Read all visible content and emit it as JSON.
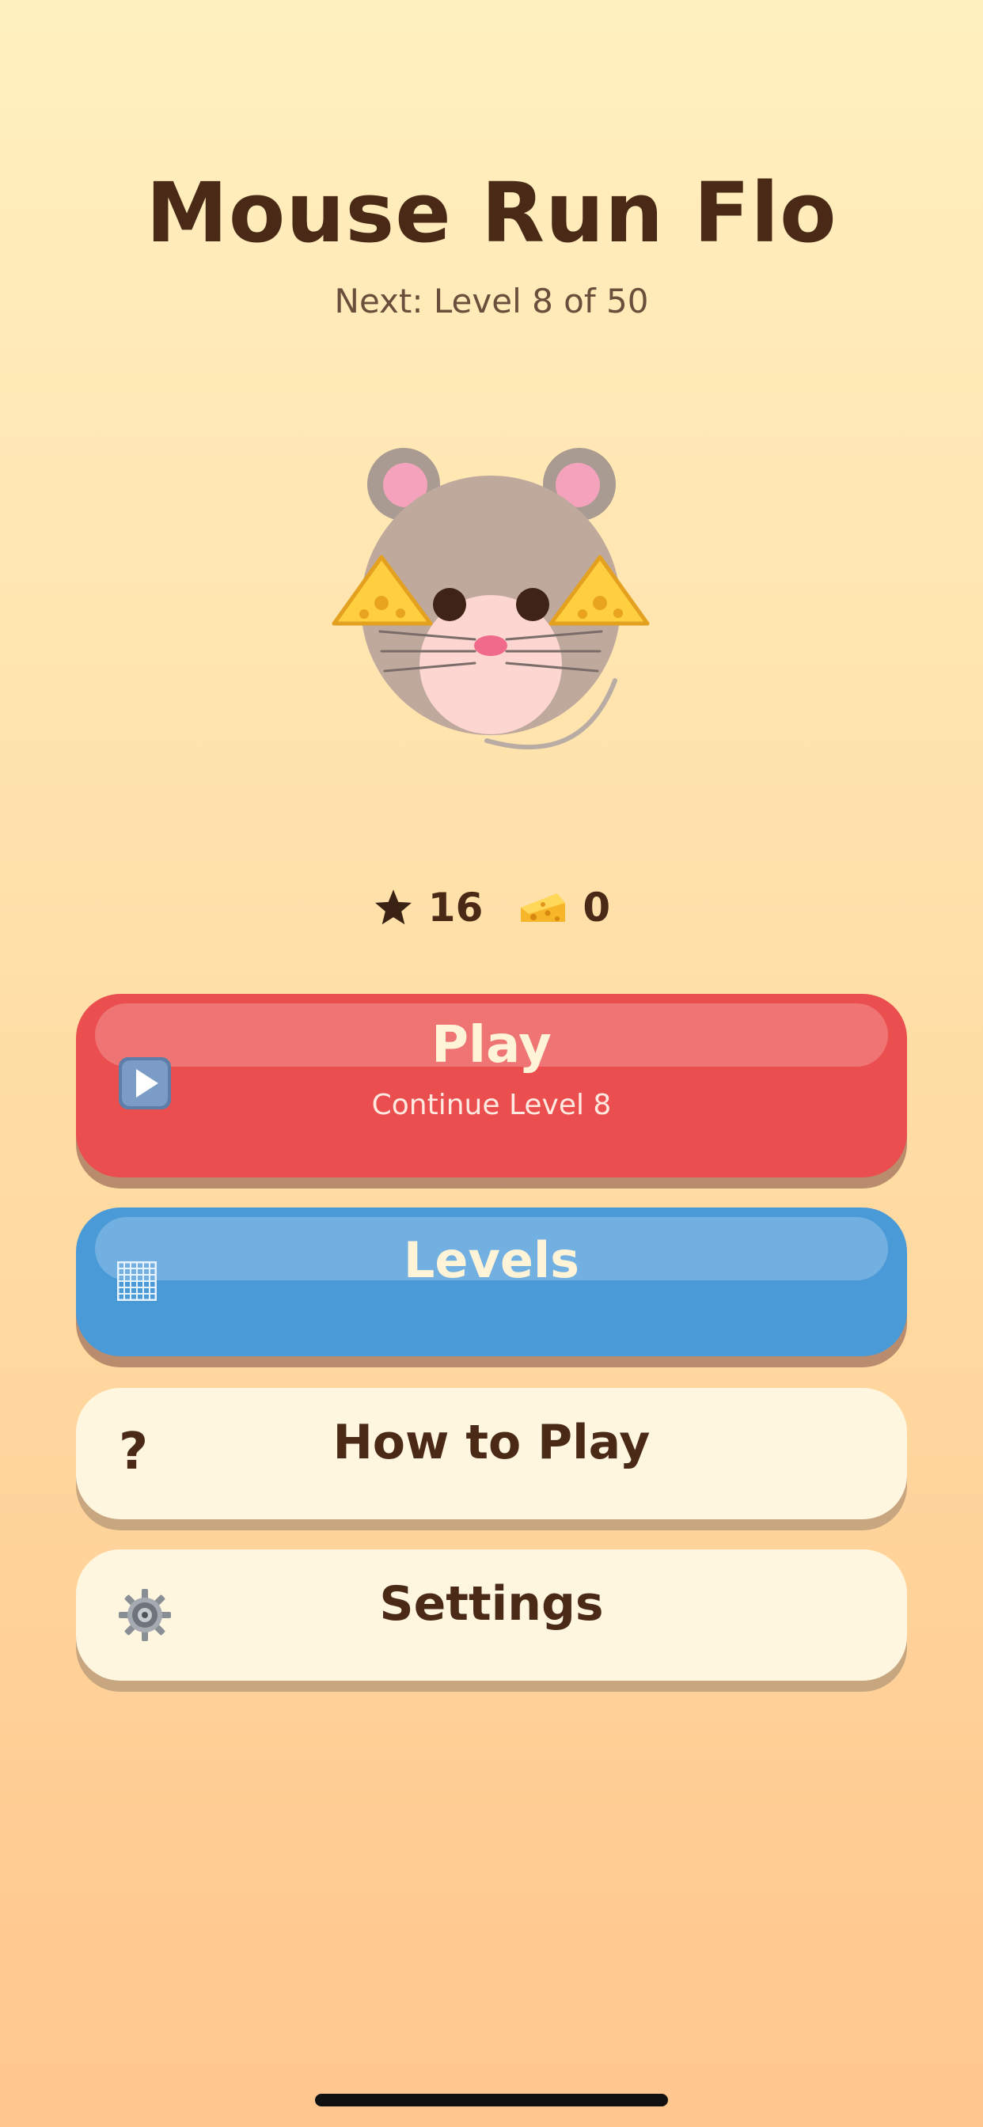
{
  "header": {
    "title": "Mouse Run Flo",
    "subtitle": "Next: Level 8 of 50"
  },
  "mascot": {
    "icon": "mouse-with-cheese-icon"
  },
  "stats": {
    "stars": {
      "icon": "star-icon",
      "value": "16"
    },
    "cheese": {
      "icon": "cheese-icon",
      "value": "0"
    }
  },
  "menu": {
    "play": {
      "label": "Play",
      "sub": "Continue Level 8",
      "icon": "play-icon",
      "color": "#eb4e4e"
    },
    "levels": {
      "label": "Levels",
      "icon": "grid-icon",
      "color": "#4a9ad8"
    },
    "how_to_play": {
      "label": "How to Play",
      "icon": "question-icon",
      "icon_glyph": "?",
      "color": "#fff6e0"
    },
    "settings": {
      "label": "Settings",
      "icon": "gear-icon",
      "color": "#fff6e0"
    }
  }
}
